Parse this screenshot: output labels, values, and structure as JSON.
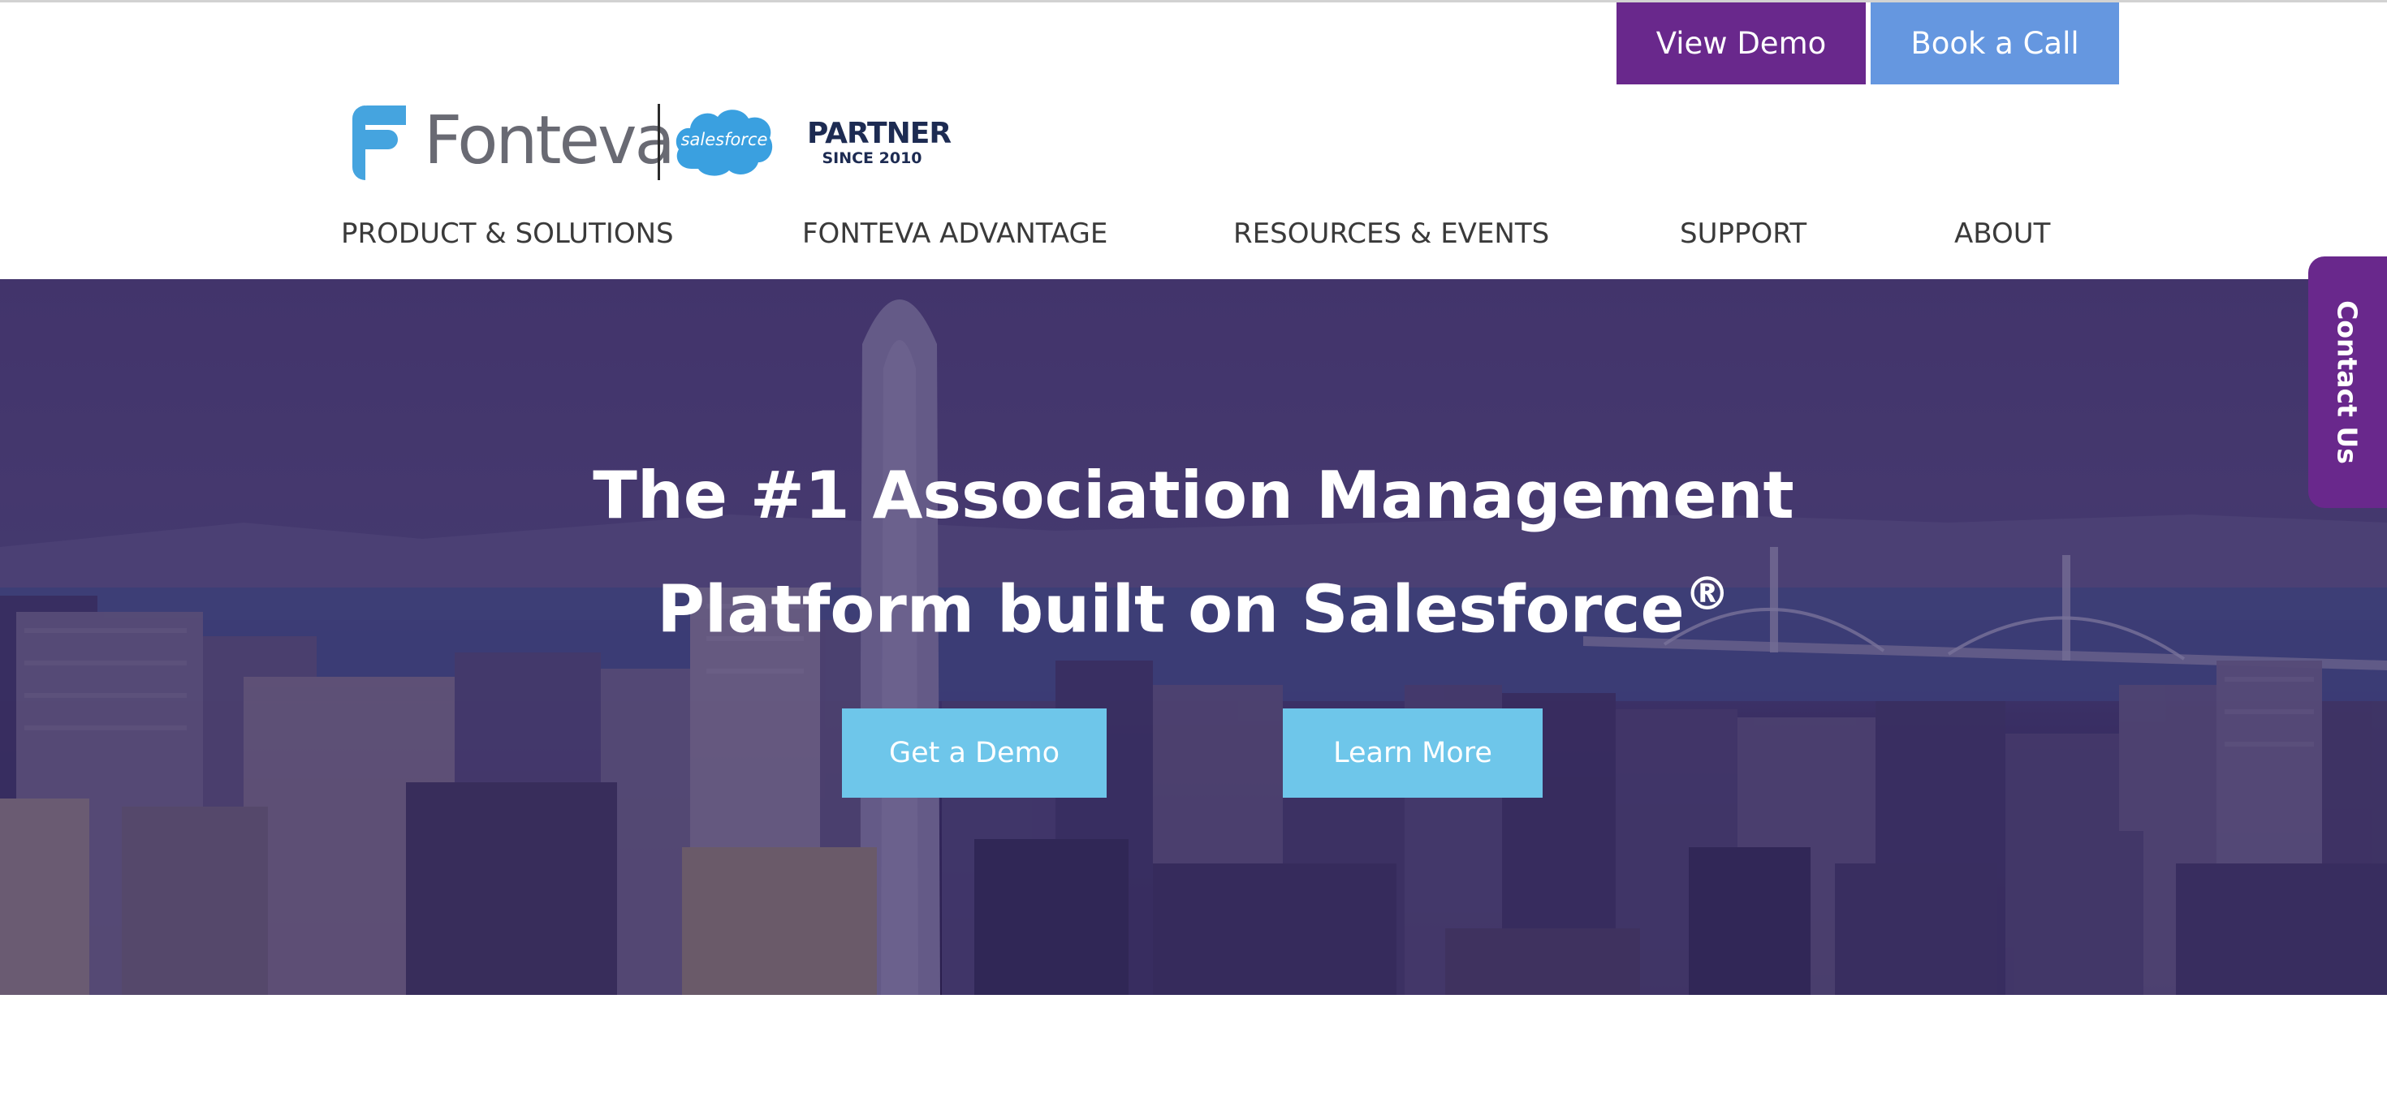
{
  "header": {
    "view_demo_label": "View Demo",
    "book_call_label": "Book a Call"
  },
  "logo": {
    "wordmark": "Fonteva",
    "partner_cloud_text": "salesforce",
    "partner_label": "PARTNER",
    "partner_since": "SINCE 2010"
  },
  "nav": {
    "items": [
      {
        "label": "PRODUCT & SOLUTIONS"
      },
      {
        "label": "FONTEVA ADVANTAGE"
      },
      {
        "label": "RESOURCES & EVENTS"
      },
      {
        "label": "SUPPORT"
      },
      {
        "label": "ABOUT"
      }
    ]
  },
  "hero": {
    "title_line_1": "The #1 Association Management",
    "title_line_2": "Platform built on Salesforce",
    "title_mark": "®",
    "get_demo_label": "Get a Demo",
    "learn_more_label": "Learn More"
  },
  "contact_tab": {
    "label": "Contact Us"
  },
  "colors": {
    "brand_purple": "#69288c",
    "brand_blue": "#6597e0",
    "cta_light_blue": "#6ec6ea",
    "logo_gray": "#696a73",
    "salesforce_blue": "#3aa0e0",
    "partner_navy": "#1d2b52"
  },
  "icons": {
    "logo_mark": "fonteva-f-logo-icon",
    "partner_cloud": "salesforce-cloud-icon"
  }
}
